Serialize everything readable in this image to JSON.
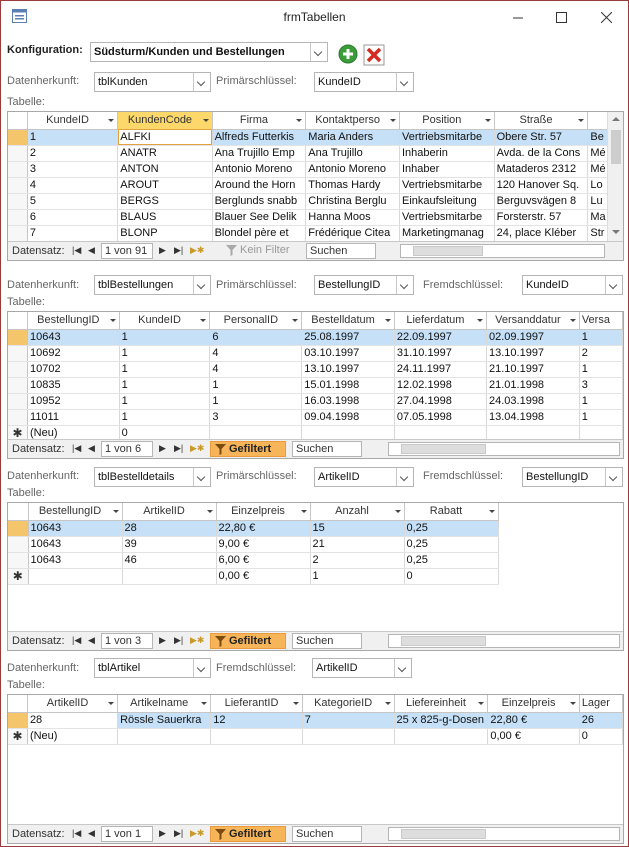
{
  "window": {
    "title": "frmTabellen",
    "minimize_icon": "minimize-icon",
    "maximize_icon": "maximize-icon",
    "close_icon": "close-icon"
  },
  "konfig": {
    "label": "Konfiguration:",
    "value": "Südsturm/Kunden und Bestellungen",
    "add_icon": "plus-circle-icon",
    "delete_icon": "red-x-icon"
  },
  "common": {
    "herkunft_label": "Datenherkunft:",
    "primaer_label": "Primärschlüssel:",
    "fremd_label": "Fremdschlüssel:",
    "tabelle_label": "Tabelle:",
    "datensatz_label": "Datensatz:",
    "search_placeholder": "Suchen",
    "new_row_symbol": "✱",
    "nav_first": "|◀",
    "nav_prev": "◀",
    "nav_next": "▶",
    "nav_last": "▶|",
    "nav_new": "▶✱"
  },
  "section1": {
    "herkunft": "tblKunden",
    "primaer": "KundeID",
    "columns": [
      "KundeID",
      "KundenCode",
      "Firma",
      "Kontaktperso",
      "Position",
      "Straße",
      ""
    ],
    "rows": [
      [
        "1",
        "ALFKI",
        "Alfreds Futterkis",
        "Maria Anders",
        "Vertriebsmitarbe",
        "Obere Str. 57",
        "Be"
      ],
      [
        "2",
        "ANATR",
        "Ana Trujillo Emp",
        "Ana Trujillo",
        "Inhaberin",
        "Avda. de la Cons",
        "Mé"
      ],
      [
        "3",
        "ANTON",
        "Antonio Moreno",
        "Antonio Moreno",
        "Inhaber",
        "Mataderos  2312",
        "Mé"
      ],
      [
        "4",
        "AROUT",
        "Around the Horn",
        "Thomas Hardy",
        "Vertriebsmitarbe",
        "120 Hanover Sq.",
        "Lo"
      ],
      [
        "5",
        "BERGS",
        "Berglunds snabb",
        "Christina Berglu",
        "Einkaufsleitung",
        "Berguvsvägen  8",
        "Lu"
      ],
      [
        "6",
        "BLAUS",
        "Blauer See Delik",
        "Hanna Moos",
        "Vertriebsmitarbe",
        "Forsterstr. 57",
        "Ma"
      ],
      [
        "7",
        "BLONP",
        "Blondel père et",
        "Frédérique Citea",
        "Marketingmanag",
        "24, place Kléber",
        "Str"
      ]
    ],
    "position": "1 von 91",
    "filter": "Kein Filter",
    "search": "Suchen"
  },
  "section2": {
    "herkunft": "tblBestellungen",
    "primaer": "BestellungID",
    "fremd": "KundeID",
    "columns": [
      "BestellungID",
      "KundeID",
      "PersonalID",
      "Bestelldatum",
      "Lieferdatum",
      "Versanddatur",
      "Versa"
    ],
    "rows": [
      [
        "10643",
        "1",
        "6",
        "25.08.1997",
        "22.09.1997",
        "02.09.1997",
        "1"
      ],
      [
        "10692",
        "1",
        "4",
        "03.10.1997",
        "31.10.1997",
        "13.10.1997",
        "2"
      ],
      [
        "10702",
        "1",
        "4",
        "13.10.1997",
        "24.11.1997",
        "21.10.1997",
        "1"
      ],
      [
        "10835",
        "1",
        "1",
        "15.01.1998",
        "12.02.1998",
        "21.01.1998",
        "3"
      ],
      [
        "10952",
        "1",
        "1",
        "16.03.1998",
        "27.04.1998",
        "24.03.1998",
        "1"
      ],
      [
        "11011",
        "1",
        "3",
        "09.04.1998",
        "07.05.1998",
        "13.04.1998",
        "1"
      ],
      [
        "(Neu)",
        "0",
        "",
        "",
        "",
        "",
        ""
      ]
    ],
    "position": "1 von 6",
    "filter": "Gefiltert",
    "search": "Suchen"
  },
  "section3": {
    "herkunft": "tblBestelldetails",
    "primaer": "ArtikelID",
    "fremd": "BestellungID",
    "columns": [
      "BestellungID",
      "ArtikelID",
      "Einzelpreis",
      "Anzahl",
      "Rabatt"
    ],
    "rows": [
      [
        "10643",
        "28",
        "22,80 €",
        "15",
        "0,25"
      ],
      [
        "10643",
        "39",
        "9,00 €",
        "21",
        "0,25"
      ],
      [
        "10643",
        "46",
        "6,00 €",
        "2",
        "0,25"
      ],
      [
        "",
        "",
        "0,00 €",
        "1",
        "0"
      ]
    ],
    "position": "1 von 3",
    "filter": "Gefiltert",
    "search": "Suchen"
  },
  "section4": {
    "herkunft": "tblArtikel",
    "fremd": "ArtikelID",
    "columns": [
      "ArtikelID",
      "Artikelname",
      "LieferantID",
      "KategorieID",
      "Liefereinheit",
      "Einzelpreis",
      "Lager"
    ],
    "rows": [
      [
        "28",
        "Rössle Sauerkra",
        "12",
        "7",
        "25 x 825-g-Dosen",
        "22,80 €",
        "26"
      ],
      [
        "(Neu)",
        "",
        "",
        "",
        "",
        "0,00 €",
        "0"
      ]
    ],
    "position": "1 von 1",
    "filter": "Gefiltert",
    "search": "Suchen"
  }
}
